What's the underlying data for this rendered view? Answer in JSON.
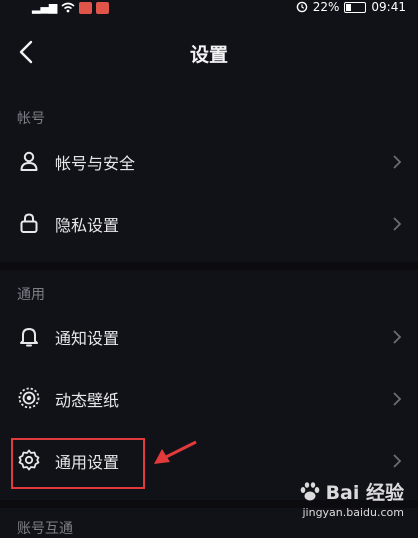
{
  "status": {
    "battery": "22%",
    "time": "09:41",
    "battery_level": 0.22
  },
  "header": {
    "title": "设置"
  },
  "sections": [
    {
      "title": "帐号",
      "items": [
        {
          "label": "帐号与安全",
          "icon": "user-icon"
        },
        {
          "label": "隐私设置",
          "icon": "lock-icon"
        }
      ]
    },
    {
      "title": "通用",
      "items": [
        {
          "label": "通知设置",
          "icon": "bell-icon"
        },
        {
          "label": "动态壁纸",
          "icon": "dynamic-wallpaper-icon"
        },
        {
          "label": "通用设置",
          "icon": "gear-icon"
        }
      ]
    },
    {
      "title": "账号互通"
    }
  ],
  "annotation": {
    "color": "#e23a3a"
  },
  "watermark": {
    "brand": "Bai  经验",
    "url": "jingyan.baidu.com"
  }
}
